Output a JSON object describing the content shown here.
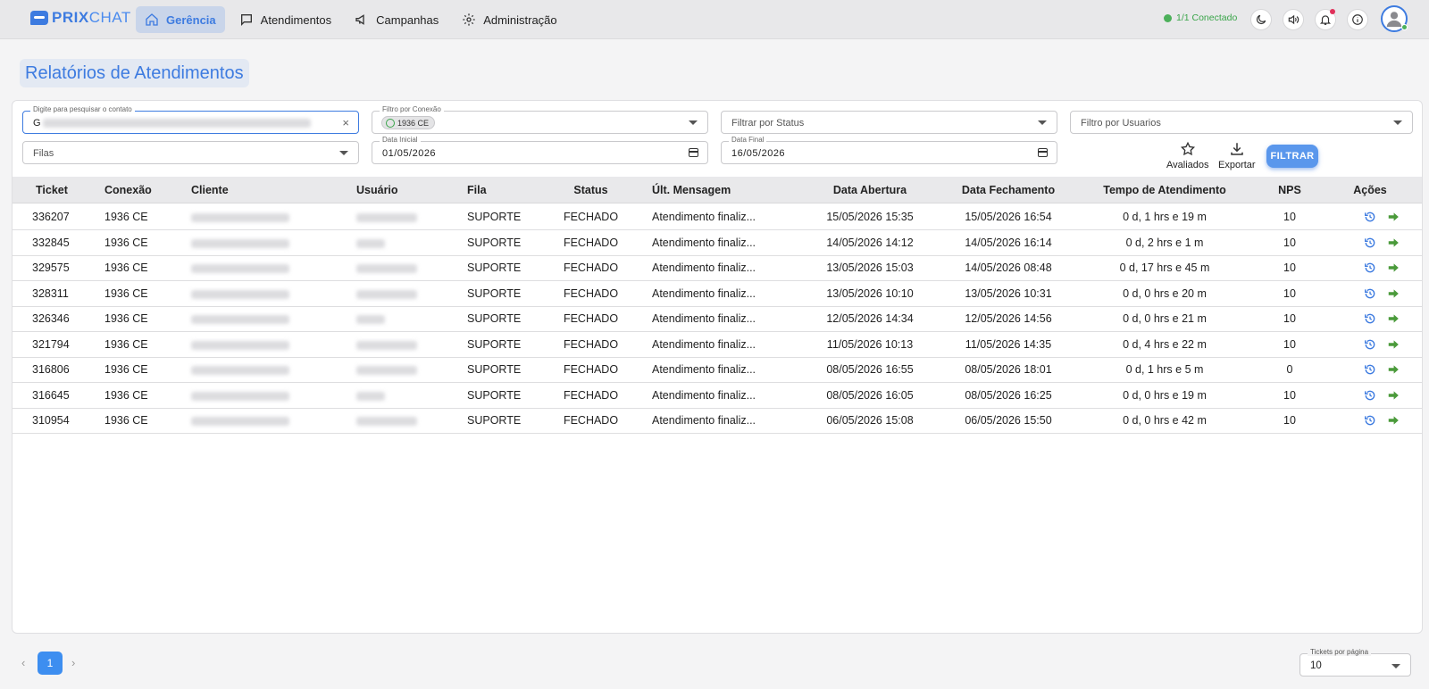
{
  "app": {
    "logo_text": "PRIX",
    "logo_text2": "CHAT"
  },
  "nav": {
    "items": [
      {
        "label": "Gerência",
        "icon": "home-icon",
        "active": true
      },
      {
        "label": "Atendimentos",
        "icon": "chat-bubble-icon"
      },
      {
        "label": "Campanhas",
        "icon": "megaphone-icon"
      },
      {
        "label": "Administração",
        "icon": "gear-icon"
      }
    ]
  },
  "header": {
    "connection_status": "1/1 Conectado",
    "icons": [
      "dark-mode-icon",
      "volume-icon",
      "bell-icon",
      "info-icon",
      "user-avatar-icon"
    ]
  },
  "page": {
    "title": "Relatórios de Atendimentos"
  },
  "filters": {
    "search": {
      "label": "Digite para pesquisar o contato",
      "value": "G"
    },
    "connection": {
      "label": "Filtro por Conexão",
      "chip": "1936 CE"
    },
    "status": {
      "placeholder": "Filtrar por Status"
    },
    "users": {
      "placeholder": "Filtro por Usuarios"
    },
    "queues": {
      "placeholder": "Filas"
    },
    "start_date": {
      "label": "Data Inicial",
      "value": "01/05/2026"
    },
    "end_date": {
      "label": "Data Final",
      "value": "16/05/2026"
    },
    "rated_label": "Avaliados",
    "export_label": "Exportar",
    "filter_button": "FILTRAR"
  },
  "table": {
    "columns": [
      "Ticket",
      "Conexão",
      "Cliente",
      "Usuário",
      "Fila",
      "Status",
      "Últ. Mensagem",
      "Data Abertura",
      "Data Fechamento",
      "Tempo de Atendimento",
      "NPS",
      "Ações"
    ],
    "rows": [
      {
        "ticket": "336207",
        "conexao": "1936 CE",
        "fila": "SUPORTE",
        "status": "FECHADO",
        "ult": "Atendimento finaliz...",
        "abertura": "15/05/2026 15:35",
        "fechamento": "15/05/2026 16:54",
        "tempo": "0 d, 1 hrs e 19 m",
        "nps": "10"
      },
      {
        "ticket": "332845",
        "conexao": "1936 CE",
        "fila": "SUPORTE",
        "status": "FECHADO",
        "ult": "Atendimento finaliz...",
        "abertura": "14/05/2026 14:12",
        "fechamento": "14/05/2026 16:14",
        "tempo": "0 d, 2 hrs e 1 m",
        "nps": "10"
      },
      {
        "ticket": "329575",
        "conexao": "1936 CE",
        "fila": "SUPORTE",
        "status": "FECHADO",
        "ult": "Atendimento finaliz...",
        "abertura": "13/05/2026 15:03",
        "fechamento": "14/05/2026 08:48",
        "tempo": "0 d, 17 hrs e 45 m",
        "nps": "10"
      },
      {
        "ticket": "328311",
        "conexao": "1936 CE",
        "fila": "SUPORTE",
        "status": "FECHADO",
        "ult": "Atendimento finaliz...",
        "abertura": "13/05/2026 10:10",
        "fechamento": "13/05/2026 10:31",
        "tempo": "0 d, 0 hrs e 20 m",
        "nps": "10"
      },
      {
        "ticket": "326346",
        "conexao": "1936 CE",
        "fila": "SUPORTE",
        "status": "FECHADO",
        "ult": "Atendimento finaliz...",
        "abertura": "12/05/2026 14:34",
        "fechamento": "12/05/2026 14:56",
        "tempo": "0 d, 0 hrs e 21 m",
        "nps": "10"
      },
      {
        "ticket": "321794",
        "conexao": "1936 CE",
        "fila": "SUPORTE",
        "status": "FECHADO",
        "ult": "Atendimento finaliz...",
        "abertura": "11/05/2026 10:13",
        "fechamento": "11/05/2026 14:35",
        "tempo": "0 d, 4 hrs e 22 m",
        "nps": "10"
      },
      {
        "ticket": "316806",
        "conexao": "1936 CE",
        "fila": "SUPORTE",
        "status": "FECHADO",
        "ult": "Atendimento finaliz...",
        "abertura": "08/05/2026 16:55",
        "fechamento": "08/05/2026 18:01",
        "tempo": "0 d, 1 hrs e 5 m",
        "nps": "0"
      },
      {
        "ticket": "316645",
        "conexao": "1936 CE",
        "fila": "SUPORTE",
        "status": "FECHADO",
        "ult": "Atendimento finaliz...",
        "abertura": "08/05/2026 16:05",
        "fechamento": "08/05/2026 16:25",
        "tempo": "0 d, 0 hrs e 19 m",
        "nps": "10"
      },
      {
        "ticket": "310954",
        "conexao": "1936 CE",
        "fila": "SUPORTE",
        "status": "FECHADO",
        "ult": "Atendimento finaliz...",
        "abertura": "06/05/2026 15:08",
        "fechamento": "06/05/2026 15:50",
        "tempo": "0 d, 0 hrs e 42 m",
        "nps": "10"
      }
    ],
    "action_icons": [
      "history-icon",
      "arrow-right-icon"
    ]
  },
  "pagination": {
    "current_page": "1",
    "per_page_label": "Tickets por página",
    "per_page_value": "10"
  },
  "colors": {
    "accent": "#3d7be0",
    "connected": "#3aa54a",
    "action_green": "#4a9a3a"
  }
}
